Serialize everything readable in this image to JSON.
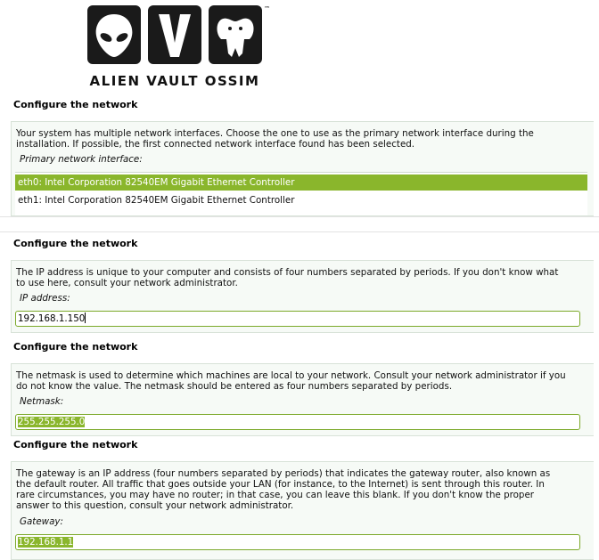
{
  "logo": {
    "text": "ALIEN VAULT OSSIM",
    "tm": "™"
  },
  "screen1": {
    "title": "Configure the network",
    "description_line1": "Your system has multiple network interfaces. Choose the one to use as the primary network interface during the",
    "description_line2": "installation. If possible, the first connected network interface found has been selected.",
    "label": "Primary network interface:",
    "interfaces": [
      "eth0: Intel Corporation 82540EM Gigabit Ethernet Controller",
      "eth1: Intel Corporation 82540EM Gigabit Ethernet Controller"
    ],
    "selected_index": 0
  },
  "screen2": {
    "title": "Configure the network",
    "description_line1": "The IP address is unique to your computer and consists of four numbers separated by periods.  If you don't know what",
    "description_line2": "to use here, consult your network administrator.",
    "label": "IP address:",
    "value": "192.168.1.150"
  },
  "screen3": {
    "title": "Configure the network",
    "description_line1": "The netmask is used to determine which machines are local to your network.  Consult your network administrator if you",
    "description_line2": "do not know the value.  The netmask should be entered as four numbers separated by periods.",
    "label": "Netmask:",
    "value": "255.255.255.0"
  },
  "screen4": {
    "title": "Configure the network",
    "description_line1": "The gateway is an IP address (four numbers separated by periods) that indicates the gateway router, also known as",
    "description_line2": "the default router.  All traffic that goes outside your LAN (for instance, to the Internet) is sent through this router.  In",
    "description_line3": "rare circumstances, you may have no router; in that case, you can leave this blank.  If you don't know the proper",
    "description_line4": "answer to this question, consult your network administrator.",
    "label": "Gateway:",
    "value": "192.168.1.1"
  },
  "colors": {
    "accent": "#8ab62c",
    "panel": "#f6faf6"
  }
}
